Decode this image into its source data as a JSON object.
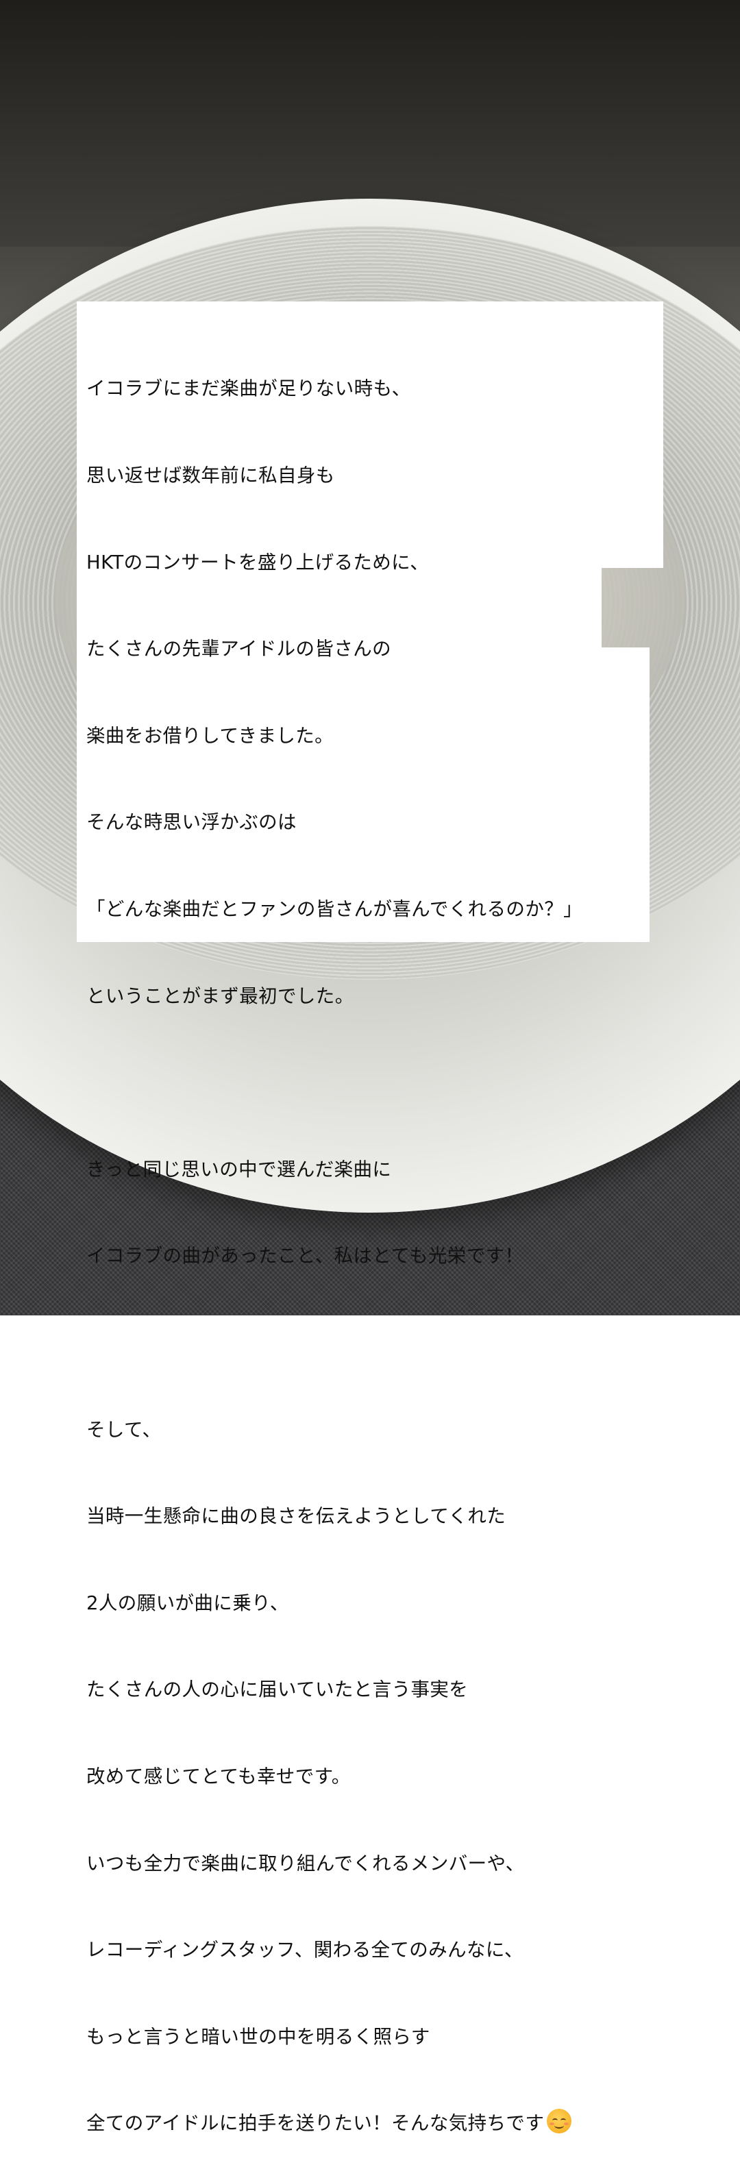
{
  "story": {
    "lines": [
      "イコラブにまだ楽曲が足りない時も、",
      "思い返せば数年前に私自身も",
      "HKTのコンサートを盛り上げるために、",
      "たくさんの先輩アイドルの皆さんの",
      "楽曲をお借りしてきました。",
      "そんな時思い浮かぶのは",
      "「どんな楽曲だとファンの皆さんが喜んでくれるのか？」",
      "ということがまず最初でした。",
      "",
      "きっと同じ思いの中で選んだ楽曲に",
      "イコラブの曲があったこと、私はとても光栄です！",
      "",
      "そして、",
      "当時一生懸命に曲の良さを伝えようとしてくれた",
      "2人の願いが曲に乗り、",
      "たくさんの人の心に届いていたと言う事実を",
      "改めて感じてとても幸せです。",
      "いつも全力で楽曲に取り組んでくれるメンバーや、",
      "レコーディングスタッフ、関わる全てのみんなに、",
      "もっと言うと暗い世の中を明るく照らす",
      "全てのアイドルに拍手を送りたい！そんな気持ちです"
    ],
    "emoji_icon": "smiling-face-icon"
  }
}
